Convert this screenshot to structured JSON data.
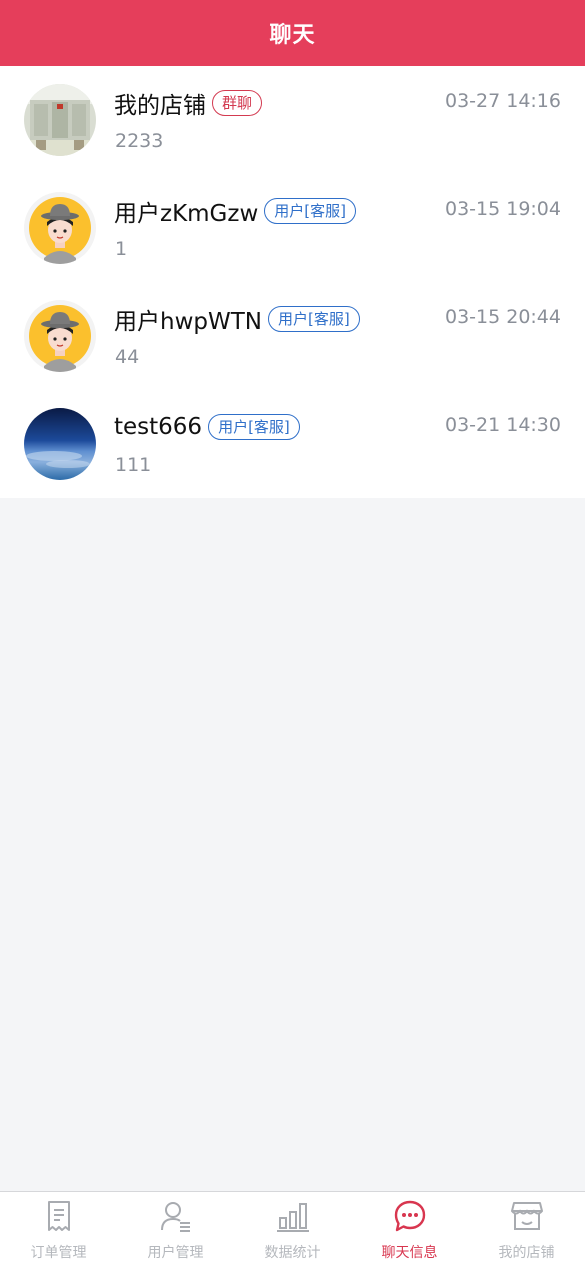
{
  "header": {
    "title": "聊天"
  },
  "chats": [
    {
      "name": "我的店铺",
      "tag": "群聊",
      "time": "03-27 14:16",
      "preview": "2233",
      "avatar": "store-photo-avatar"
    },
    {
      "name": "用户zKmGzw",
      "tag": "用户[客服]",
      "time": "03-15 19:04",
      "preview": "1",
      "avatar": "cartoon-user-avatar"
    },
    {
      "name": "用户hwpWTN",
      "tag": "用户[客服]",
      "time": "03-15 20:44",
      "preview": "44",
      "avatar": "cartoon-user-avatar"
    },
    {
      "name": "test666",
      "tag": "用户[客服]",
      "time": "03-21 14:30",
      "preview": "111",
      "avatar": "earth-avatar"
    }
  ],
  "tabbar": {
    "items": [
      {
        "label": "订单管理",
        "icon": "receipt-icon"
      },
      {
        "label": "用户管理",
        "icon": "user-list-icon"
      },
      {
        "label": "数据统计",
        "icon": "bar-chart-icon"
      },
      {
        "label": "聊天信息",
        "icon": "chat-bubble-icon",
        "active": true
      },
      {
        "label": "我的店铺",
        "icon": "store-icon"
      }
    ]
  },
  "colors": {
    "brand": "#e53e5b",
    "active_tab": "#d8364f",
    "tag_blue": "#2f6fc9",
    "muted": "#8a8f98"
  }
}
